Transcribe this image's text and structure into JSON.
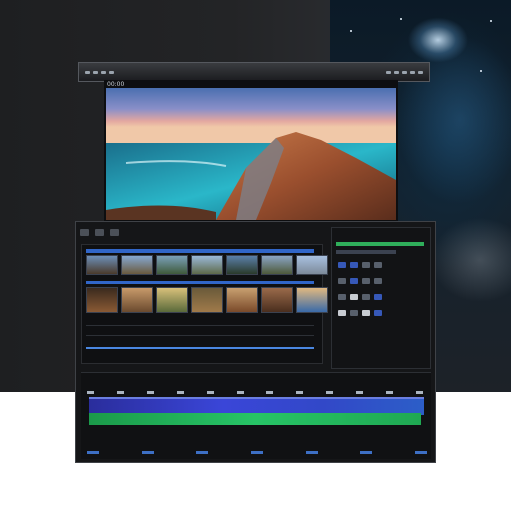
{
  "preview": {
    "title": "00:00"
  },
  "editor": {
    "toolbar_label": "",
    "timeline_label": ""
  },
  "colors": {
    "video_track": "#3a46d8",
    "audio_track": "#27c466",
    "accent": "#3166c8"
  },
  "icons": [
    "play-icon",
    "settings-icon",
    "scissors-icon"
  ]
}
